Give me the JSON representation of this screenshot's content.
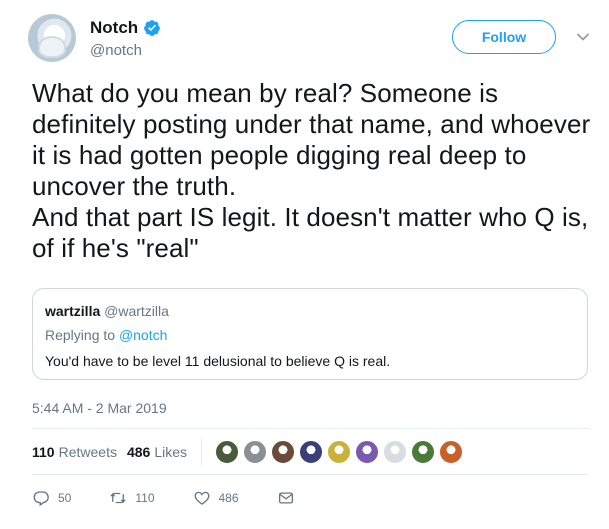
{
  "header": {
    "display_name": "Notch",
    "handle": "@notch",
    "follow_label": "Follow",
    "verified_icon": "verified-check-icon",
    "accent_color": "#1da1f2"
  },
  "tweet": {
    "text": "What do you mean by real? Someone is definitely posting under that name, and whoever it is had gotten people digging real deep to uncover the truth.\nAnd that part IS legit. It doesn't matter who Q is, of if he's \"real\""
  },
  "quote": {
    "display_name": "wartzilla",
    "handle": "@wartzilla",
    "replying_prefix": "Replying to ",
    "replying_to": "@notch",
    "text": "You'd have to be level 11 delusional to believe Q is real."
  },
  "timestamp": "5:44 AM - 2 Mar 2019",
  "stats": {
    "retweets_count": "110",
    "retweets_label": "Retweets",
    "likes_count": "486",
    "likes_label": "Likes",
    "liker_colors": [
      "#4a5a3a",
      "#8a8f96",
      "#6b4a3a",
      "#3a3f7a",
      "#c9b23a",
      "#7a5ab0",
      "#d8dde2",
      "#4a7a3a",
      "#c8602a"
    ]
  },
  "actions": {
    "reply_count": "50",
    "retweet_count": "110",
    "like_count": "486"
  }
}
